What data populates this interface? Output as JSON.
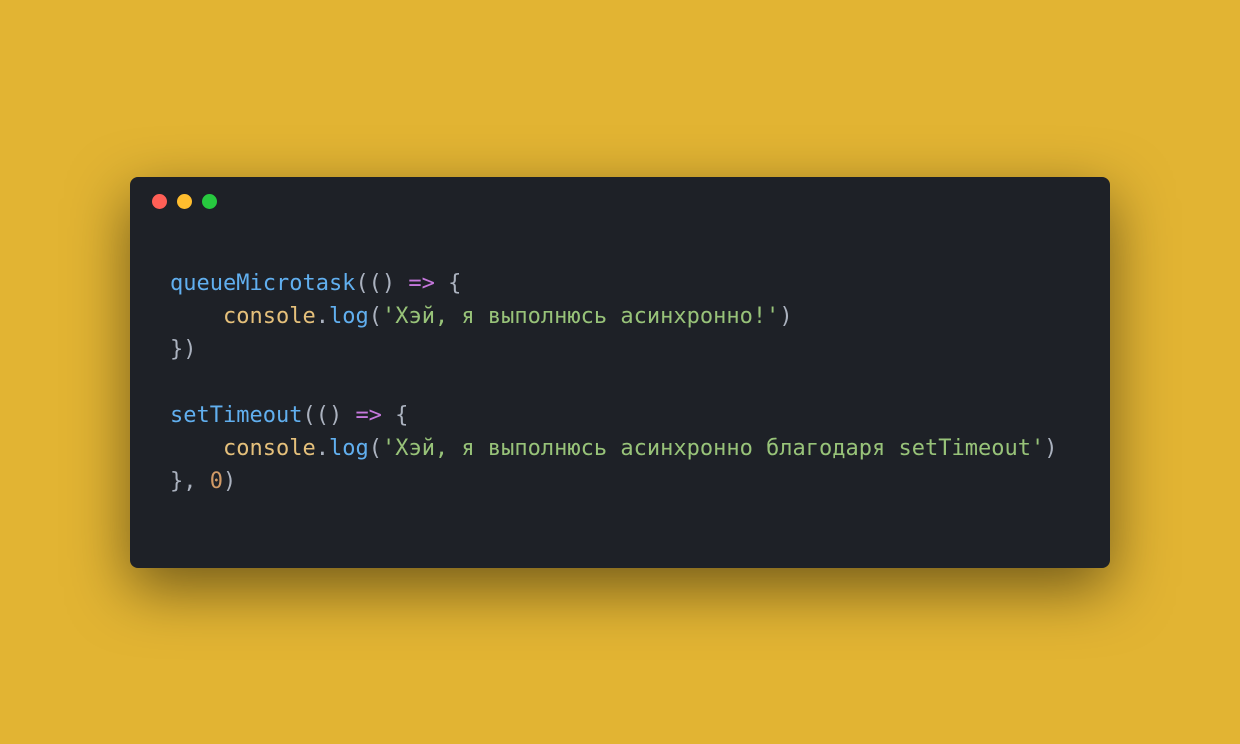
{
  "window": {
    "traffic_lights": [
      "red",
      "yellow",
      "green"
    ]
  },
  "code": {
    "line1": {
      "fn": "queueMicrotask",
      "open": "(() ",
      "arrow": "=>",
      "brace": " {"
    },
    "line2": {
      "indent": "    ",
      "obj": "console",
      "dot": ".",
      "method": "log",
      "open": "(",
      "str": "'Хэй, я выполнюсь асинхронно!'",
      "close": ")"
    },
    "line3": {
      "text": "})"
    },
    "line4": {
      "text": ""
    },
    "line5": {
      "fn": "setTimeout",
      "open": "(() ",
      "arrow": "=>",
      "brace": " {"
    },
    "line6": {
      "indent": "    ",
      "obj": "console",
      "dot": ".",
      "method": "log",
      "open": "(",
      "str": "'Хэй, я выполнюсь асинхронно благодаря setTimeout'",
      "close": ")"
    },
    "line7": {
      "close": "}, ",
      "num": "0",
      "paren": ")"
    }
  }
}
